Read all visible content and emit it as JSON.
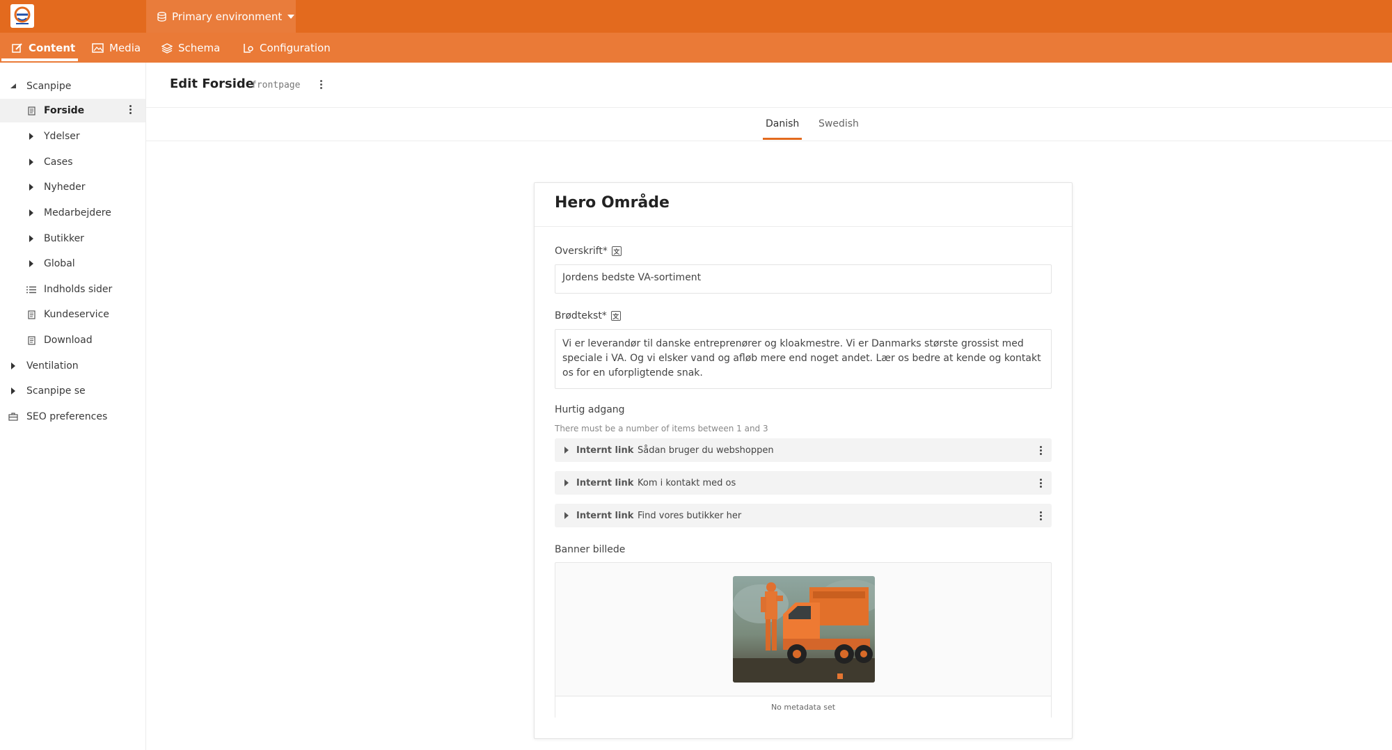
{
  "topbar": {
    "environment_label": "Primary environment"
  },
  "nav": {
    "items": [
      {
        "label": "Content",
        "icon": "edit-icon",
        "active": true
      },
      {
        "label": "Media",
        "icon": "image-icon",
        "active": false
      },
      {
        "label": "Schema",
        "icon": "layers-icon",
        "active": false
      },
      {
        "label": "Configuration",
        "icon": "config-icon",
        "active": false
      }
    ]
  },
  "sidebar": {
    "items": [
      {
        "label": "Scanpipe",
        "icon": "caret-down-icon",
        "level": 0
      },
      {
        "label": "Forside",
        "icon": "page-icon",
        "level": 1,
        "selected": true
      },
      {
        "label": "Ydelser",
        "icon": "caret-right-icon",
        "level": 1
      },
      {
        "label": "Cases",
        "icon": "caret-right-icon",
        "level": 1
      },
      {
        "label": "Nyheder",
        "icon": "caret-right-icon",
        "level": 1
      },
      {
        "label": "Medarbejdere",
        "icon": "caret-right-icon",
        "level": 1
      },
      {
        "label": "Butikker",
        "icon": "caret-right-icon",
        "level": 1
      },
      {
        "label": "Global",
        "icon": "caret-right-icon",
        "level": 1
      },
      {
        "label": "Indholds sider",
        "icon": "list-icon",
        "level": 1
      },
      {
        "label": "Kundeservice",
        "icon": "page-icon",
        "level": 1
      },
      {
        "label": "Download",
        "icon": "page-icon",
        "level": 1
      },
      {
        "label": "Ventilation",
        "icon": "caret-right-icon",
        "level": 0
      },
      {
        "label": "Scanpipe se",
        "icon": "caret-right-icon",
        "level": 0
      },
      {
        "label": "SEO preferences",
        "icon": "briefcase-icon",
        "level": 0
      }
    ]
  },
  "header": {
    "title": "Edit Forside",
    "schema_name": "frontpage"
  },
  "languages": {
    "tabs": [
      {
        "label": "Danish",
        "active": true
      },
      {
        "label": "Swedish",
        "active": false
      }
    ]
  },
  "card": {
    "title": "Hero Område",
    "fields": {
      "headline": {
        "label": "Overskrift*",
        "value": "Jordens bedste VA-sortiment"
      },
      "body": {
        "label": "Brødtekst*",
        "value": "Vi er leverandør til danske entreprenører og kloakmestre. Vi er Danmarks største grossist med speciale i VA. Og vi elsker vand og afløb mere end noget andet. Lær os bedre at kende og kontakt os for en uforpligtende snak."
      },
      "quick_access": {
        "label": "Hurtig adgang",
        "hint": "There must be a number of items between 1 and 3",
        "items": [
          {
            "type": "Internt link",
            "value": "Sådan bruger du webshoppen"
          },
          {
            "type": "Internt link",
            "value": "Kom i kontakt med os"
          },
          {
            "type": "Internt link",
            "value": "Find vores butikker her"
          }
        ]
      },
      "banner": {
        "label": "Banner billede",
        "metadata": "No metadata set"
      }
    }
  },
  "colors": {
    "brand_orange": "#e36a1e",
    "nav_orange": "#ea7a37"
  }
}
